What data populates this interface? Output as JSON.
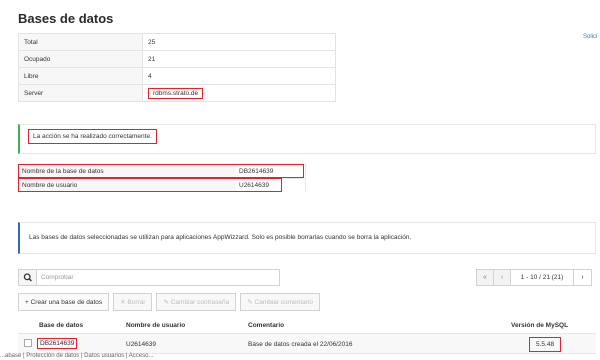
{
  "page": {
    "title": "Bases de datos",
    "side_link": "Solici"
  },
  "summary": [
    {
      "label": "Total",
      "value": "25"
    },
    {
      "label": "Ocupado",
      "value": "21"
    },
    {
      "label": "Libre",
      "value": "4"
    },
    {
      "label": "Server",
      "value": "rdbms.strato.de"
    }
  ],
  "success": {
    "message": "La acción se ha realizado correctamente."
  },
  "details": [
    {
      "label": "Nombre de la base de datos",
      "value": "DB2614639"
    },
    {
      "label": "Nombre de usuario",
      "value": "U2614639"
    }
  ],
  "note": {
    "text": "Las bases de datos seleccionadas se utilizan para aplicaciones AppWizzard. Solo es posible borrarlas cuando se borra la aplicación."
  },
  "search": {
    "placeholder": "Comprobar",
    "value": ""
  },
  "pager": {
    "first": "«",
    "prev": "‹",
    "info": "1 - 10 / 21 (21)",
    "next": "›"
  },
  "toolbar": {
    "create": "+ Crear una base de datos",
    "delete": "✕ Borrar",
    "change_password": "✎ Cambiar contraseña",
    "change_comment": "✎ Cambiar comentario"
  },
  "grid": {
    "headers": {
      "db": "Base de datos",
      "user": "Nombre de usuario",
      "comment": "Comentario",
      "mysql": "Versión de MySQL"
    },
    "rows": [
      {
        "db": "DB2614639",
        "user": "U2614639",
        "comment": "Base de datos creada el 22/06/2016",
        "mysql": "5.5.48"
      }
    ]
  },
  "breadcrumb": "...abase | Protección de datos | Datos usuarios | Acceso..."
}
